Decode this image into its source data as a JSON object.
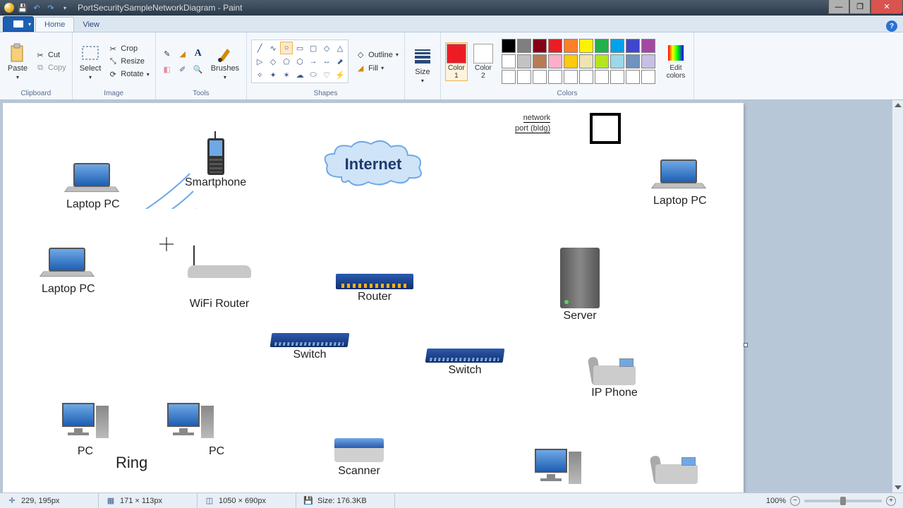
{
  "title": "PortSecuritySampleNetworkDiagram - Paint",
  "tabs": {
    "home": "Home",
    "view": "View"
  },
  "clipboard": {
    "paste": "Paste",
    "cut": "Cut",
    "copy": "Copy",
    "label": "Clipboard"
  },
  "image": {
    "select": "Select",
    "crop": "Crop",
    "resize": "Resize",
    "rotate": "Rotate",
    "label": "Image"
  },
  "tools": {
    "brushes": "Brushes",
    "label": "Tools"
  },
  "shapes": {
    "outline": "Outline",
    "fill": "Fill",
    "label": "Shapes"
  },
  "size": {
    "label": "Size"
  },
  "colors": {
    "c1": "Color\n1",
    "c2": "Color\n2",
    "edit": "Edit\ncolors",
    "label": "Colors",
    "current1": "#ed1c24",
    "current2": "#ffffff",
    "palette": [
      "#000000",
      "#7f7f7f",
      "#880015",
      "#ed1c24",
      "#ff7f27",
      "#fff200",
      "#22b14c",
      "#00a2e8",
      "#3f48cc",
      "#a349a4",
      "#ffffff",
      "#c3c3c3",
      "#b97a57",
      "#ffaec9",
      "#ffc90e",
      "#efe4b0",
      "#b5e61d",
      "#99d9ea",
      "#7092be",
      "#c8bfe7",
      "#ffffff",
      "#ffffff",
      "#ffffff",
      "#ffffff",
      "#ffffff",
      "#ffffff",
      "#ffffff",
      "#ffffff",
      "#ffffff",
      "#ffffff"
    ]
  },
  "canvas": {
    "nodes": {
      "laptop1": "Laptop PC",
      "laptop2": "Laptop PC",
      "laptop3": "Laptop PC",
      "smartphone": "Smartphone",
      "internet": "Internet",
      "router": "Router",
      "wifirouter": "WiFi Router",
      "switch1": "Switch",
      "switch2": "Switch",
      "server": "Server",
      "ipphone": "IP Phone",
      "pc1": "PC",
      "pc2": "PC",
      "ring": "Ring",
      "scanner": "Scanner"
    },
    "port_label_l1": "network",
    "port_label_l2": "port (bldg)"
  },
  "status": {
    "pos": "229, 195px",
    "sel": "171 × 113px",
    "dim": "1050 × 690px",
    "size": "Size: 176.3KB",
    "zoom": "100%"
  }
}
